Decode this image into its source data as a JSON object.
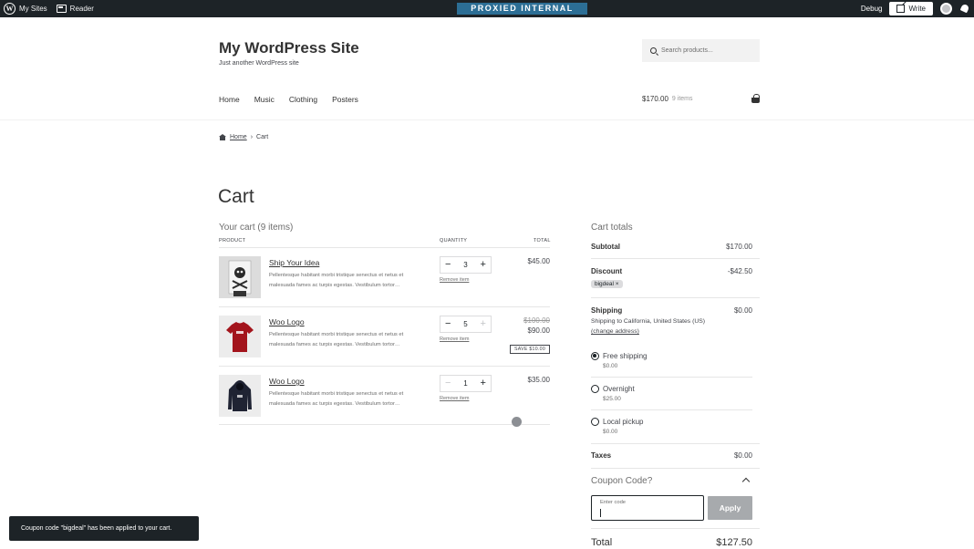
{
  "admin_bar": {
    "my_sites": "My Sites",
    "reader": "Reader",
    "banner": "PROXIED INTERNAL",
    "debug": "Debug",
    "write": "Write"
  },
  "site": {
    "title": "My WordPress Site",
    "tagline": "Just another WordPress site",
    "search_placeholder": "Search products..."
  },
  "nav": {
    "items": [
      "Home",
      "Music",
      "Clothing",
      "Posters"
    ]
  },
  "header_cart": {
    "amount": "$170.00",
    "items": "9 items"
  },
  "breadcrumb": {
    "home": "Home",
    "sep": "›",
    "current": "Cart"
  },
  "page": {
    "title": "Cart",
    "your_cart": "Your cart (9 items)"
  },
  "table_headers": {
    "product": "PRODUCT",
    "quantity": "QUANTITY",
    "total": "TOTAL"
  },
  "cart_items": [
    {
      "name": "Ship Your Idea",
      "desc": "Pellentesque habitant morbi tristique senectus et netus et malesuada fames ac turpis egestas. Vestibulum tortor…",
      "qty": "3",
      "remove": "Remove item",
      "price": "$45.00"
    },
    {
      "name": "Woo Logo",
      "desc": "Pellentesque habitant morbi tristique senectus et netus et malesuada fames ac turpis egestas. Vestibulum tortor…",
      "qty": "5",
      "remove": "Remove item",
      "old_price": "$100.00",
      "price": "$90.00",
      "badge": "SAVE $10.00"
    },
    {
      "name": "Woo Logo",
      "desc": "Pellentesque habitant morbi tristique senectus et netus et malesuada fames ac turpis egestas. Vestibulum tortor…",
      "qty": "1",
      "remove": "Remove item",
      "price": "$35.00"
    }
  ],
  "totals": {
    "title": "Cart totals",
    "subtotal_label": "Subtotal",
    "subtotal": "$170.00",
    "discount_label": "Discount",
    "discount": "-$42.50",
    "coupon_chip": "bigdeal",
    "shipping_label": "Shipping",
    "shipping": "$0.00",
    "shipping_to": "Shipping to California, United States (US)",
    "change_address": "(change address)",
    "options": [
      {
        "label": "Free shipping",
        "price": "$0.00",
        "selected": true
      },
      {
        "label": "Overnight",
        "price": "$25.00",
        "selected": false
      },
      {
        "label": "Local pickup",
        "price": "$0.00",
        "selected": false
      }
    ],
    "taxes_label": "Taxes",
    "taxes": "$0.00",
    "coupon_title": "Coupon Code?",
    "code_label": "Enter code",
    "apply": "Apply",
    "total_label": "Total",
    "total": "$127.50"
  },
  "toast": "Coupon code \"bigdeal\" has been applied to your cart.",
  "colors": {
    "admin_bar": "#1d2327",
    "banner": "#2c6e95",
    "apply_button": "#a7aaad"
  }
}
